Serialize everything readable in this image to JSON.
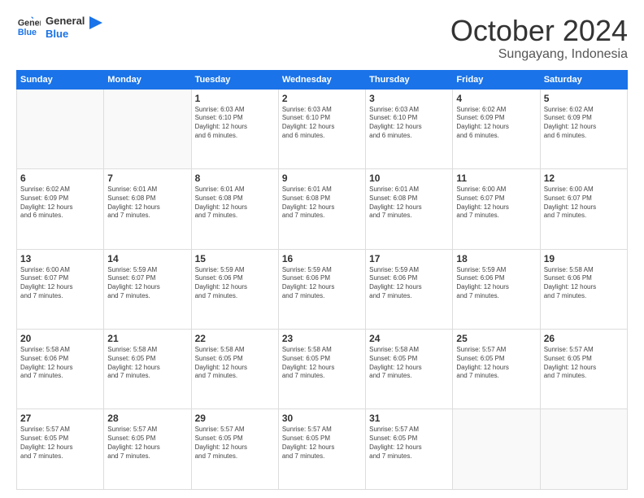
{
  "logo": {
    "line1": "General",
    "line2": "Blue"
  },
  "header": {
    "month": "October 2024",
    "location": "Sungayang, Indonesia"
  },
  "weekdays": [
    "Sunday",
    "Monday",
    "Tuesday",
    "Wednesday",
    "Thursday",
    "Friday",
    "Saturday"
  ],
  "weeks": [
    [
      {
        "day": "",
        "info": ""
      },
      {
        "day": "",
        "info": ""
      },
      {
        "day": "1",
        "info": "Sunrise: 6:03 AM\nSunset: 6:10 PM\nDaylight: 12 hours\nand 6 minutes."
      },
      {
        "day": "2",
        "info": "Sunrise: 6:03 AM\nSunset: 6:10 PM\nDaylight: 12 hours\nand 6 minutes."
      },
      {
        "day": "3",
        "info": "Sunrise: 6:03 AM\nSunset: 6:10 PM\nDaylight: 12 hours\nand 6 minutes."
      },
      {
        "day": "4",
        "info": "Sunrise: 6:02 AM\nSunset: 6:09 PM\nDaylight: 12 hours\nand 6 minutes."
      },
      {
        "day": "5",
        "info": "Sunrise: 6:02 AM\nSunset: 6:09 PM\nDaylight: 12 hours\nand 6 minutes."
      }
    ],
    [
      {
        "day": "6",
        "info": "Sunrise: 6:02 AM\nSunset: 6:09 PM\nDaylight: 12 hours\nand 6 minutes."
      },
      {
        "day": "7",
        "info": "Sunrise: 6:01 AM\nSunset: 6:08 PM\nDaylight: 12 hours\nand 7 minutes."
      },
      {
        "day": "8",
        "info": "Sunrise: 6:01 AM\nSunset: 6:08 PM\nDaylight: 12 hours\nand 7 minutes."
      },
      {
        "day": "9",
        "info": "Sunrise: 6:01 AM\nSunset: 6:08 PM\nDaylight: 12 hours\nand 7 minutes."
      },
      {
        "day": "10",
        "info": "Sunrise: 6:01 AM\nSunset: 6:08 PM\nDaylight: 12 hours\nand 7 minutes."
      },
      {
        "day": "11",
        "info": "Sunrise: 6:00 AM\nSunset: 6:07 PM\nDaylight: 12 hours\nand 7 minutes."
      },
      {
        "day": "12",
        "info": "Sunrise: 6:00 AM\nSunset: 6:07 PM\nDaylight: 12 hours\nand 7 minutes."
      }
    ],
    [
      {
        "day": "13",
        "info": "Sunrise: 6:00 AM\nSunset: 6:07 PM\nDaylight: 12 hours\nand 7 minutes."
      },
      {
        "day": "14",
        "info": "Sunrise: 5:59 AM\nSunset: 6:07 PM\nDaylight: 12 hours\nand 7 minutes."
      },
      {
        "day": "15",
        "info": "Sunrise: 5:59 AM\nSunset: 6:06 PM\nDaylight: 12 hours\nand 7 minutes."
      },
      {
        "day": "16",
        "info": "Sunrise: 5:59 AM\nSunset: 6:06 PM\nDaylight: 12 hours\nand 7 minutes."
      },
      {
        "day": "17",
        "info": "Sunrise: 5:59 AM\nSunset: 6:06 PM\nDaylight: 12 hours\nand 7 minutes."
      },
      {
        "day": "18",
        "info": "Sunrise: 5:59 AM\nSunset: 6:06 PM\nDaylight: 12 hours\nand 7 minutes."
      },
      {
        "day": "19",
        "info": "Sunrise: 5:58 AM\nSunset: 6:06 PM\nDaylight: 12 hours\nand 7 minutes."
      }
    ],
    [
      {
        "day": "20",
        "info": "Sunrise: 5:58 AM\nSunset: 6:06 PM\nDaylight: 12 hours\nand 7 minutes."
      },
      {
        "day": "21",
        "info": "Sunrise: 5:58 AM\nSunset: 6:05 PM\nDaylight: 12 hours\nand 7 minutes."
      },
      {
        "day": "22",
        "info": "Sunrise: 5:58 AM\nSunset: 6:05 PM\nDaylight: 12 hours\nand 7 minutes."
      },
      {
        "day": "23",
        "info": "Sunrise: 5:58 AM\nSunset: 6:05 PM\nDaylight: 12 hours\nand 7 minutes."
      },
      {
        "day": "24",
        "info": "Sunrise: 5:58 AM\nSunset: 6:05 PM\nDaylight: 12 hours\nand 7 minutes."
      },
      {
        "day": "25",
        "info": "Sunrise: 5:57 AM\nSunset: 6:05 PM\nDaylight: 12 hours\nand 7 minutes."
      },
      {
        "day": "26",
        "info": "Sunrise: 5:57 AM\nSunset: 6:05 PM\nDaylight: 12 hours\nand 7 minutes."
      }
    ],
    [
      {
        "day": "27",
        "info": "Sunrise: 5:57 AM\nSunset: 6:05 PM\nDaylight: 12 hours\nand 7 minutes."
      },
      {
        "day": "28",
        "info": "Sunrise: 5:57 AM\nSunset: 6:05 PM\nDaylight: 12 hours\nand 7 minutes."
      },
      {
        "day": "29",
        "info": "Sunrise: 5:57 AM\nSunset: 6:05 PM\nDaylight: 12 hours\nand 7 minutes."
      },
      {
        "day": "30",
        "info": "Sunrise: 5:57 AM\nSunset: 6:05 PM\nDaylight: 12 hours\nand 7 minutes."
      },
      {
        "day": "31",
        "info": "Sunrise: 5:57 AM\nSunset: 6:05 PM\nDaylight: 12 hours\nand 7 minutes."
      },
      {
        "day": "",
        "info": ""
      },
      {
        "day": "",
        "info": ""
      }
    ]
  ]
}
